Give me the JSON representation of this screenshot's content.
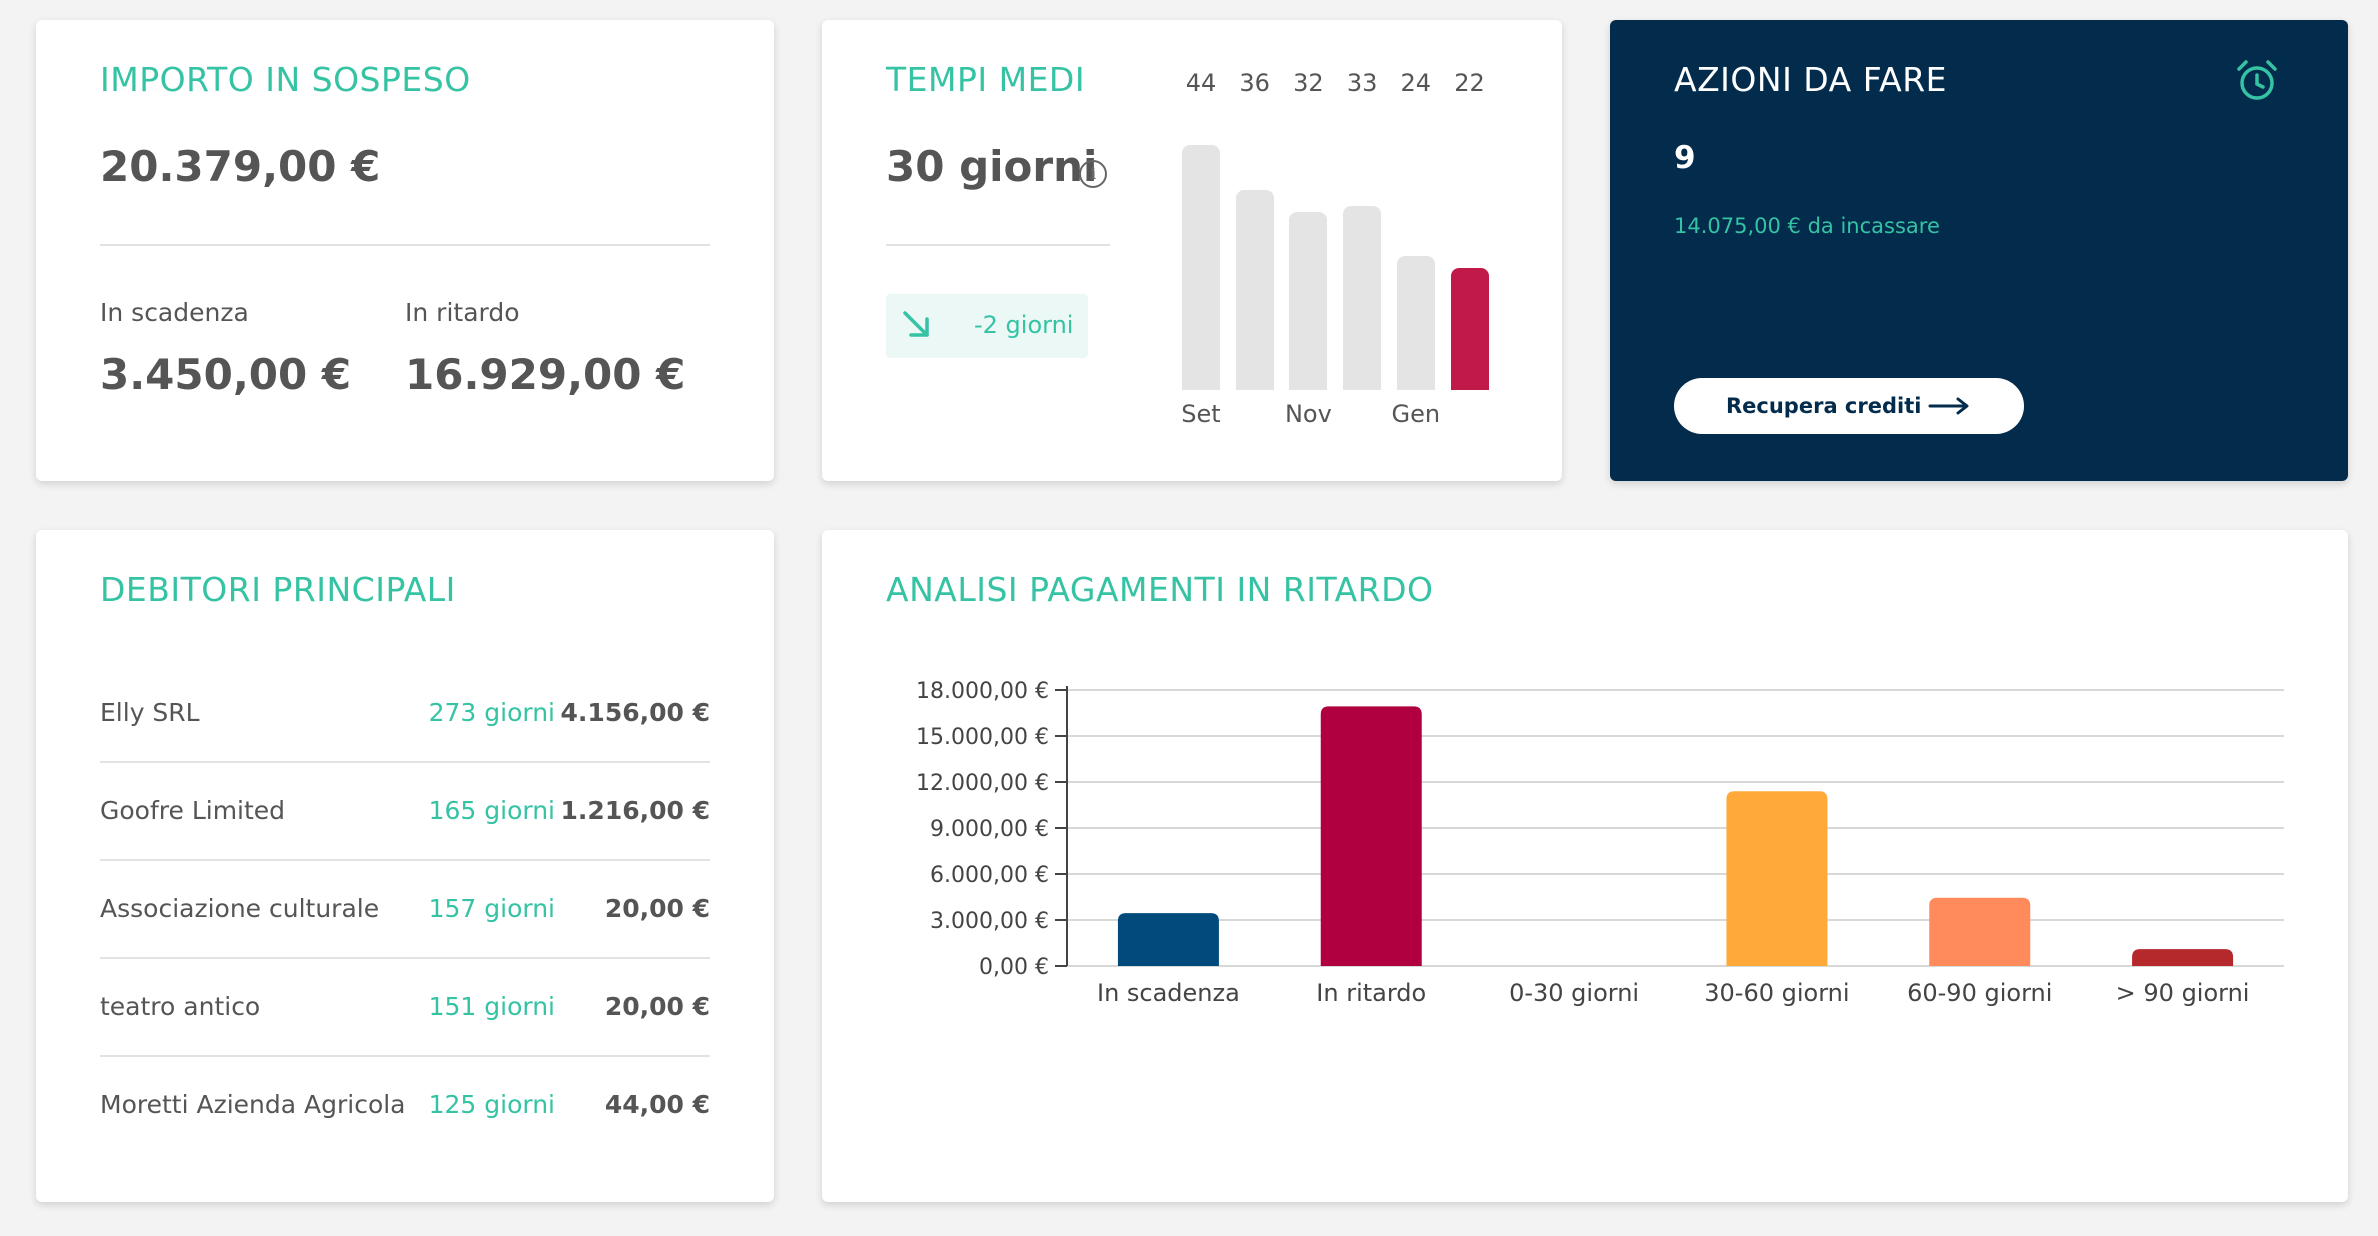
{
  "card_importo": {
    "title": "IMPORTO IN SOSPESO",
    "total": "20.379,00 €",
    "in_scadenza_label": "In scadenza",
    "in_scadenza_value": "3.450,00 €",
    "in_ritardo_label": "In ritardo",
    "in_ritardo_value": "16.929,00 €"
  },
  "card_tempi": {
    "title": "TEMPI MEDI",
    "value": "30 giorni",
    "info_icon": "info-icon",
    "trend_icon": "arrow-down-right-icon",
    "trend_text": "-2 giorni",
    "mini_chart": {
      "values": [
        44,
        36,
        32,
        33,
        24,
        22
      ],
      "value_labels": [
        "44",
        "36",
        "32",
        "33",
        "24",
        "22"
      ],
      "x_labels": [
        "Set",
        "",
        "Nov",
        "",
        "Gen",
        ""
      ],
      "highlight_color": "#c21a48",
      "bar_color": "#e4e4e4"
    }
  },
  "card_azioni": {
    "title": "AZIONI DA FARE",
    "count": "9",
    "subtitle": "14.075,00 € da incassare",
    "button_label": "Recupera crediti",
    "icon": "alarm-clock-icon",
    "background": "#022b4c"
  },
  "card_debitori": {
    "title": "DEBITORI PRINCIPALI",
    "rows": [
      {
        "name": "Elly SRL",
        "days": "273 giorni",
        "amount": "4.156,00 €"
      },
      {
        "name": "Goofre Limited",
        "days": "165 giorni",
        "amount": "1.216,00 €"
      },
      {
        "name": "Associazione culturale",
        "days": "157 giorni",
        "amount": "20,00 €"
      },
      {
        "name": "teatro antico",
        "days": "151 giorni",
        "amount": "20,00 €"
      },
      {
        "name": "Moretti Azienda Agricola",
        "days": "125 giorni",
        "amount": "44,00 €"
      }
    ]
  },
  "card_analisi": {
    "title": "ANALISI PAGAMENTI IN RITARDO"
  },
  "chart_data": {
    "type": "bar",
    "categories": [
      "In scadenza",
      "In ritardo",
      "0-30 giorni",
      "30-60 giorni",
      "60-90 giorni",
      "> 90 giorni"
    ],
    "values": [
      3450,
      16929,
      0,
      11400,
      4450,
      1100
    ],
    "colors": [
      "#004a7c",
      "#b0003f",
      "#cccccc",
      "#ffa93a",
      "#ff8a5c",
      "#b5282c"
    ],
    "ylim": [
      0,
      18000
    ],
    "yticks": [
      0,
      3000,
      6000,
      9000,
      12000,
      15000,
      18000
    ],
    "ytick_labels": [
      "0,00 €",
      "3.000,00 €",
      "6.000,00 €",
      "9.000,00 €",
      "12.000,00 €",
      "15.000,00 €",
      "18.000,00 €"
    ],
    "grid": true,
    "xlabel": "",
    "ylabel": ""
  },
  "colors": {
    "accent": "#35c3a4",
    "dark": "#022b4c",
    "text": "#555555",
    "background": "#f3f3f3"
  }
}
